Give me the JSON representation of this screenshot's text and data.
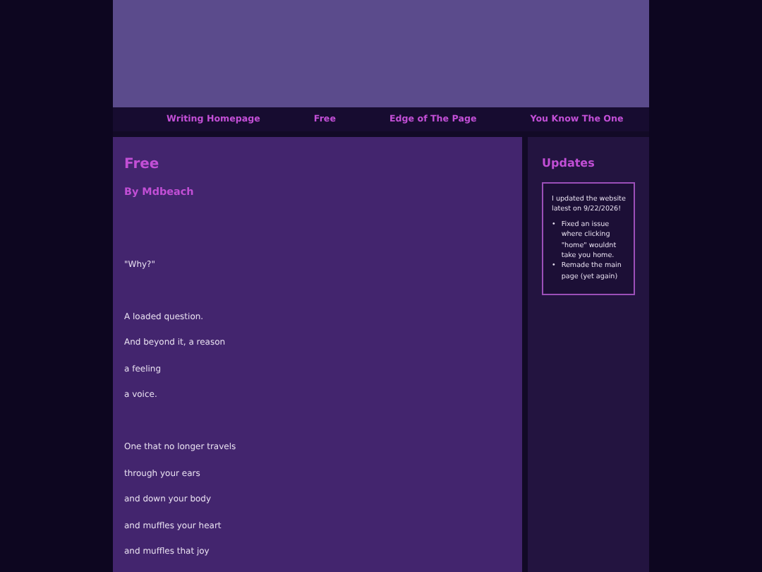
{
  "nav": [
    {
      "label": "Writing Homepage"
    },
    {
      "label": "Free"
    },
    {
      "label": "Edge of The Page"
    },
    {
      "label": "You Know The One"
    }
  ],
  "article": {
    "title": "Free",
    "author": "By Mdbeach",
    "stanzas": [
      [
        "\"Why?\""
      ],
      [
        "A loaded question.",
        "And beyond it, a reason",
        "a feeling",
        "a voice."
      ],
      [
        "One that no longer travels",
        "through your ears",
        "and down your body",
        "and muffles your heart",
        "and muffles that joy"
      ]
    ]
  },
  "sidebar": {
    "title": "Updates",
    "intro": "I updated the website latest on 9/22/2026!",
    "items": [
      {
        "bullet": "•",
        "text": "Fixed an issue where clicking \"home\" wouldnt take you home."
      },
      {
        "bullet": "•",
        "text": "Remade the main page (yet again)"
      }
    ]
  }
}
